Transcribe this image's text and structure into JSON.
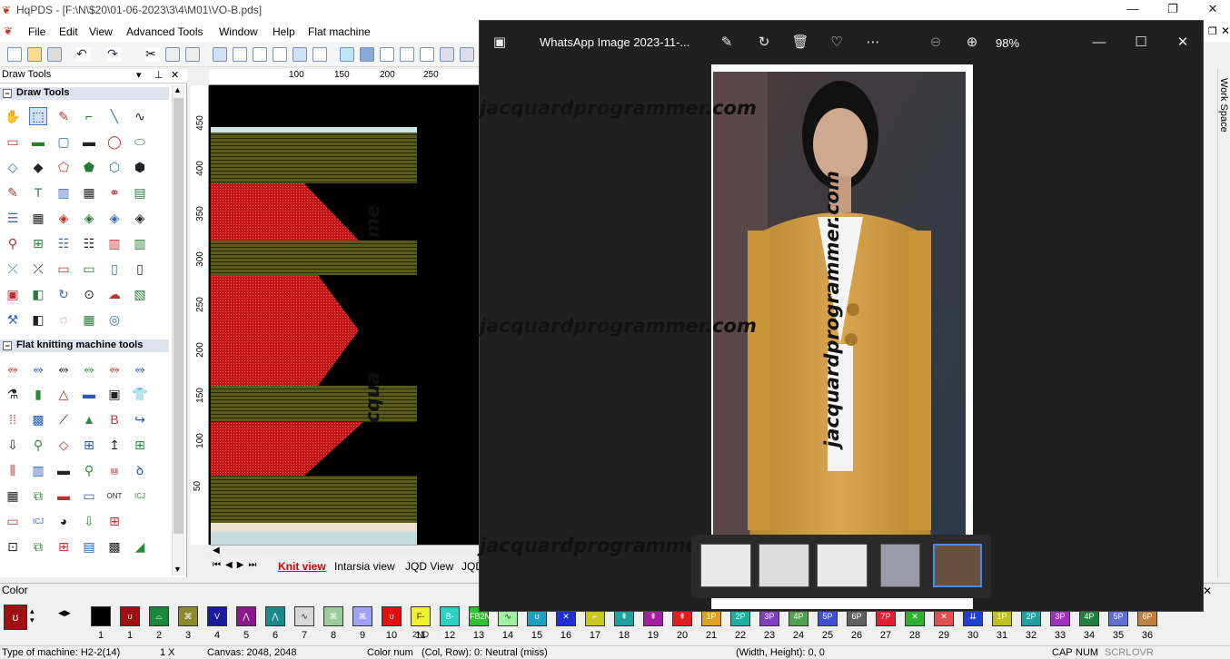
{
  "window": {
    "title": "HqPDS - [F:\\N\\$20\\01-06-2023\\3\\4\\M01\\VO-B.pds]"
  },
  "menu": [
    "File",
    "Edit",
    "View",
    "Advanced Tools",
    "Window",
    "Help",
    "Flat machine"
  ],
  "left_panel": {
    "header": "Draw Tools",
    "group1": "Draw Tools",
    "group2": "Flat knitting machine tools"
  },
  "ruler": {
    "h": [
      "100",
      "150",
      "200",
      "250"
    ],
    "v": [
      "450",
      "400",
      "350",
      "300",
      "250",
      "200",
      "150",
      "100",
      "50"
    ]
  },
  "canvas_tabs": [
    "Knit view",
    "Intarsia view",
    "JQD View",
    "JQD"
  ],
  "canvas_watermark": [
    "me",
    "cqua"
  ],
  "color_panel": {
    "title": "Color",
    "swatches": [
      {
        "num": "1",
        "color": "#000000"
      },
      {
        "num": "1",
        "color": "#a01010",
        "icon": "ʊ"
      },
      {
        "num": "2",
        "color": "#1a8a3a",
        "icon": "⌓"
      },
      {
        "num": "3",
        "color": "#8a8a30",
        "icon": "⌘"
      },
      {
        "num": "4",
        "color": "#1a1a9a",
        "icon": "V"
      },
      {
        "num": "5",
        "color": "#8a1a8a",
        "icon": "⋀"
      },
      {
        "num": "6",
        "color": "#1a8a8a",
        "icon": "⋀"
      },
      {
        "num": "7",
        "color": "#d8d8d8",
        "icon": "∿"
      },
      {
        "num": "8",
        "color": "#9acd9a",
        "icon": "⌘"
      },
      {
        "num": "9",
        "color": "#a0a0ff",
        "icon": "⌘"
      },
      {
        "num": "10",
        "color": "#e01010",
        "icon": "ʊ"
      },
      {
        "num": "11",
        "color": "#f0f030",
        "icon": "F-2ND"
      },
      {
        "num": "12",
        "color": "#30d0c0",
        "icon": "B-2ND"
      },
      {
        "num": "13",
        "color": "#30c030",
        "icon": "FB2ND"
      },
      {
        "num": "14",
        "color": "#a0f0a0",
        "icon": "∿"
      },
      {
        "num": "15",
        "color": "#20a0c0",
        "icon": "ʊ"
      },
      {
        "num": "16",
        "color": "#2030d0",
        "icon": "✕"
      },
      {
        "num": "17",
        "color": "#c8c820",
        "icon": "⌐"
      },
      {
        "num": "18",
        "color": "#20a0a0",
        "icon": "⇞"
      },
      {
        "num": "19",
        "color": "#a020a0",
        "icon": "⇞"
      },
      {
        "num": "20",
        "color": "#e02020",
        "icon": "⇞"
      },
      {
        "num": "21",
        "color": "#e0a020",
        "icon": "1P"
      },
      {
        "num": "22",
        "color": "#20b0a0",
        "icon": "2P"
      },
      {
        "num": "23",
        "color": "#8040c0",
        "icon": "3P"
      },
      {
        "num": "24",
        "color": "#50a050",
        "icon": "4P"
      },
      {
        "num": "25",
        "color": "#4050d0",
        "icon": "5P"
      },
      {
        "num": "26",
        "color": "#606060",
        "icon": "6P"
      },
      {
        "num": "27",
        "color": "#e02030",
        "icon": "7P"
      },
      {
        "num": "28",
        "color": "#30b030",
        "icon": "✕"
      },
      {
        "num": "29",
        "color": "#e05050",
        "icon": "✕"
      },
      {
        "num": "30",
        "color": "#2040d0",
        "icon": "⇊"
      },
      {
        "num": "31",
        "color": "#c0c020",
        "icon": "1P"
      },
      {
        "num": "32",
        "color": "#20a0a0",
        "icon": "2P"
      },
      {
        "num": "33",
        "color": "#a030c0",
        "icon": "3P"
      },
      {
        "num": "34",
        "color": "#208040",
        "icon": "4P"
      },
      {
        "num": "35",
        "color": "#6070d0",
        "icon": "5P"
      },
      {
        "num": "36",
        "color": "#c08040",
        "icon": "6P"
      }
    ]
  },
  "status": {
    "machine": "Type of machine: H2-2(14)",
    "zoom": "1 X",
    "canvas": "Canvas: 2048, 2048",
    "color_num": "Color num",
    "colrow": "(Col, Row): 0: Neutral (miss)",
    "size": "(Width, Height): 0, 0",
    "cap": "CAP",
    "num": "NUM",
    "scrl": "SCRL",
    "ovr": "OVR"
  },
  "workspace_label": "Work Space",
  "viewer": {
    "title": "WhatsApp Image 2023-11-...",
    "zoom": "98%",
    "watermark": "jacquardprogrammer.com"
  }
}
